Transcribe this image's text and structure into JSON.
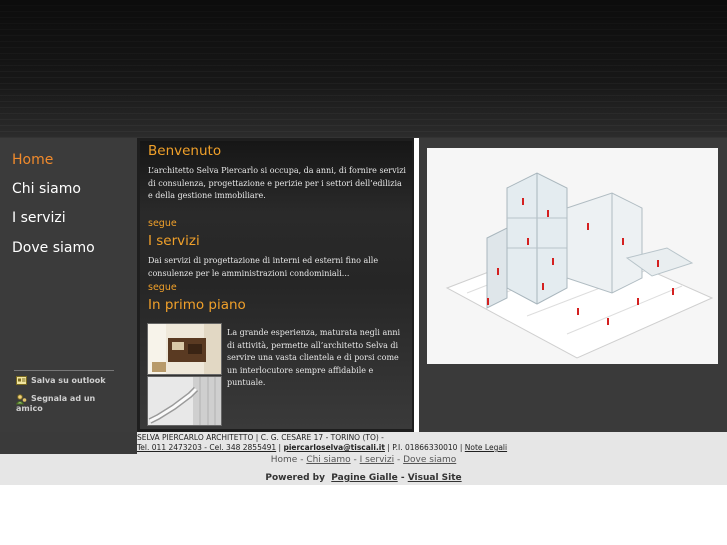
{
  "nav": {
    "items": [
      {
        "label": "Home",
        "active": true
      },
      {
        "label": "Chi siamo",
        "active": false
      },
      {
        "label": "I servizi",
        "active": false
      },
      {
        "label": "Dove siamo",
        "active": false
      }
    ]
  },
  "sidebar": {
    "save_label": "Salva su outlook",
    "share_label_1": "Segnala ad un",
    "share_label_2": "amico"
  },
  "content": {
    "welcome_title": "Benvenuto",
    "welcome_text": "L’architetto Selva Piercarlo si occupa, da anni, di fornire servizi di consulenza, progettazione e perizie per i settori dell’edilizia e della gestione immobiliare.",
    "segue1": "segue",
    "services_title": "I servizi",
    "services_text": "Dai servizi di progettazione di interni ed esterni fino alle consulenze per le amministrazioni condominiali...",
    "segue2": "segue",
    "highlight_title": "In primo piano",
    "highlight_text": "La grande esperienza, maturata negli anni di attività, permette all’architetto Selva di servire una vasta clientela e di porsi come un interlocutore sempre affidabile e puntuale."
  },
  "footer": {
    "line1": "SELVA PIERCARLO ARCHITETTO | C. G. CESARE 17 - TORINO (TO) -",
    "tel": "Tel. 011 2473203 - Cel. 348 2855491",
    "sep1": " | ",
    "email": "piercarloselva@tiscali.it",
    "piva": " | P.I. 01866330010 | ",
    "legal": "Note Legali"
  },
  "bottom_nav": {
    "home": "Home",
    "sep": "  -  ",
    "chi_siamo": "Chi siamo",
    "servizi": "I servizi",
    "dove_siamo": "Dove siamo"
  },
  "powered": {
    "label": "Powered by",
    "pagine_gialle": "Pagine Gialle",
    "dash": "-",
    "visual_site": "Visual Site"
  },
  "colors": {
    "accent": "#f08a2c",
    "title": "#f0a02a"
  }
}
